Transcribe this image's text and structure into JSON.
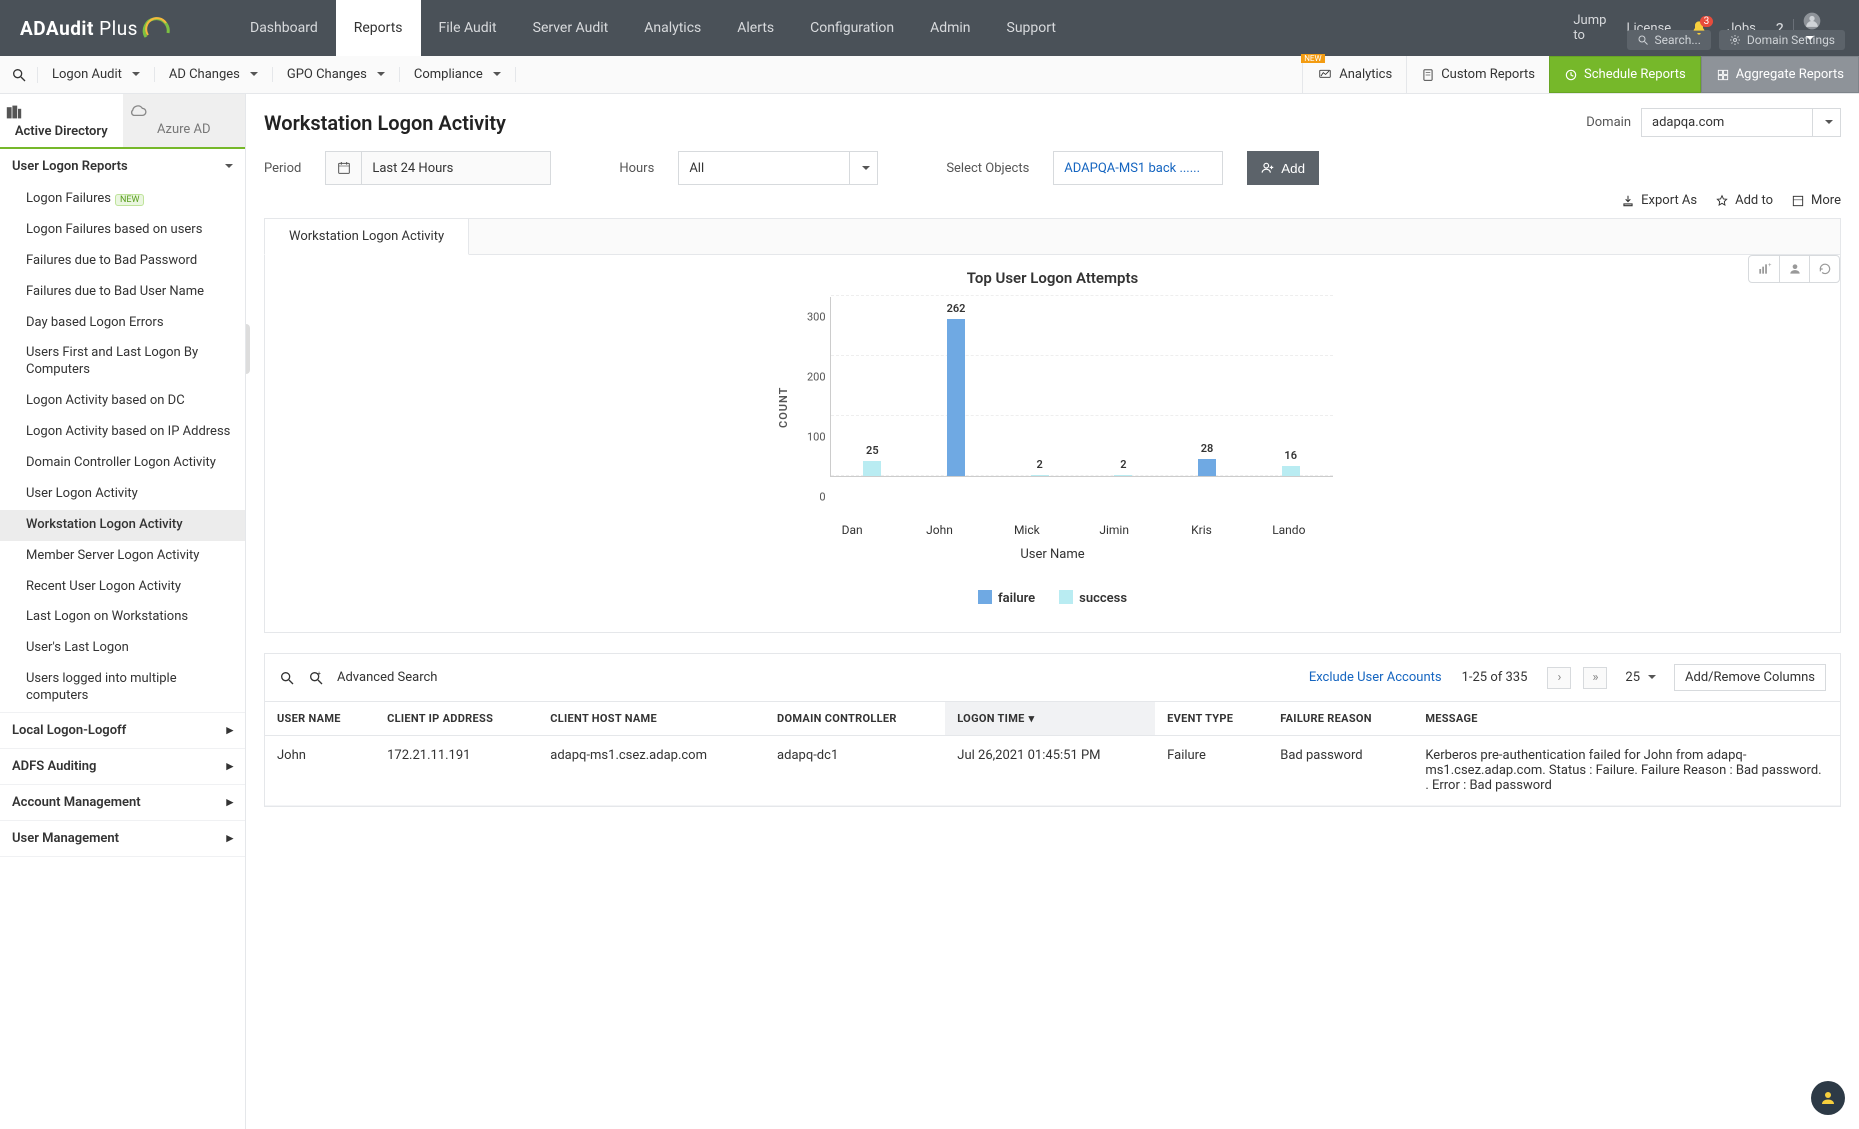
{
  "brand": {
    "name_a": "ADAudit",
    "name_b": " Plus"
  },
  "top_tabs": [
    "Dashboard",
    "Reports",
    "File Audit",
    "Server Audit",
    "Analytics",
    "Alerts",
    "Configuration",
    "Admin",
    "Support"
  ],
  "top_tabs_active_index": 1,
  "top_right": {
    "jump_to": "Jump to",
    "license": "License",
    "notif_count": "3",
    "jobs": "Jobs",
    "search": "Search...",
    "domain_settings": "Domain Settings"
  },
  "sub_dd": [
    "Logon Audit",
    "AD Changes",
    "GPO Changes",
    "Compliance"
  ],
  "sub_right": {
    "analytics": "Analytics",
    "custom_reports": "Custom Reports",
    "schedule_reports": "Schedule Reports",
    "aggregate_reports": "Aggregate Reports",
    "new_label": "NEW"
  },
  "side_tabs": {
    "ad": "Active Directory",
    "azure": "Azure AD"
  },
  "side_group_main": "User Logon Reports",
  "side_items": [
    {
      "label": "Logon Failures",
      "new": true
    },
    {
      "label": "Logon Failures based on users"
    },
    {
      "label": "Failures due to Bad Password"
    },
    {
      "label": "Failures due to Bad User Name"
    },
    {
      "label": "Day based Logon Errors"
    },
    {
      "label": "Users First and Last Logon By Computers"
    },
    {
      "label": "Logon Activity based on DC"
    },
    {
      "label": "Logon Activity based on IP Address"
    },
    {
      "label": "Domain Controller Logon Activity"
    },
    {
      "label": "User Logon Activity"
    },
    {
      "label": "Workstation Logon Activity",
      "selected": true
    },
    {
      "label": "Member Server Logon Activity"
    },
    {
      "label": "Recent User Logon Activity"
    },
    {
      "label": "Last Logon on Workstations"
    },
    {
      "label": "User's Last Logon"
    },
    {
      "label": "Users logged into multiple computers"
    }
  ],
  "side_groups_collapsed": [
    "Local Logon-Logoff",
    "ADFS Auditing",
    "Account Management",
    "User Management"
  ],
  "page": {
    "title": "Workstation Logon Activity",
    "domain_label": "Domain",
    "domain_value": "adapqa.com",
    "period_label": "Period",
    "period_value": "Last 24 Hours",
    "hours_label": "Hours",
    "hours_value": "All",
    "select_objects_label": "Select Objects",
    "select_objects_value": "ADAPQA-MS1 back ......",
    "add_btn": "Add",
    "export_as": "Export As",
    "add_to": "Add to",
    "more": "More",
    "card_tab": "Workstation Logon Activity"
  },
  "chart_data": {
    "type": "bar",
    "title": "Top User Logon Attempts",
    "xlabel": "User Name",
    "ylabel": "COUNT",
    "ylim": [
      0,
      300
    ],
    "yticks": [
      0,
      100,
      200,
      300
    ],
    "categories": [
      "Dan",
      "John",
      "Mick",
      "Jimin",
      "Kris",
      "Lando"
    ],
    "series": [
      {
        "name": "failure",
        "color": "#6fa9e3",
        "values": [
          0,
          262,
          0,
          0,
          28,
          0
        ]
      },
      {
        "name": "success",
        "color": "#b9ecf2",
        "values": [
          25,
          0,
          2,
          2,
          0,
          16
        ]
      }
    ],
    "bar_labels": [
      "25",
      "262",
      "2",
      "2",
      "28",
      "16"
    ],
    "bar_label_series": [
      "success",
      "failure",
      "success",
      "success",
      "failure",
      "success"
    ],
    "legend": [
      "failure",
      "success"
    ]
  },
  "table": {
    "advanced_search": "Advanced Search",
    "exclude_link": "Exclude User Accounts",
    "range": "1-25 of 335",
    "page_size": "25",
    "add_remove": "Add/Remove Columns",
    "new_pill": "NEW",
    "columns": [
      "USER NAME",
      "CLIENT IP ADDRESS",
      "CLIENT HOST NAME",
      "DOMAIN CONTROLLER",
      "LOGON TIME",
      "EVENT TYPE",
      "FAILURE REASON",
      "MESSAGE"
    ],
    "sorted_col_index": 4,
    "rows": [
      {
        "user": "John",
        "ip": "172.21.11.191",
        "host": "adapq-ms1.csez.adap.com",
        "dc": "adapq-dc1",
        "time": "Jul 26,2021 01:45:51 PM",
        "event": "Failure",
        "reason": "Bad password",
        "msg": "Kerberos pre-authentication failed for John from adapq-ms1.csez.adap.com. Status : Failure. Failure Reason : Bad password. . Error : Bad password"
      }
    ]
  }
}
